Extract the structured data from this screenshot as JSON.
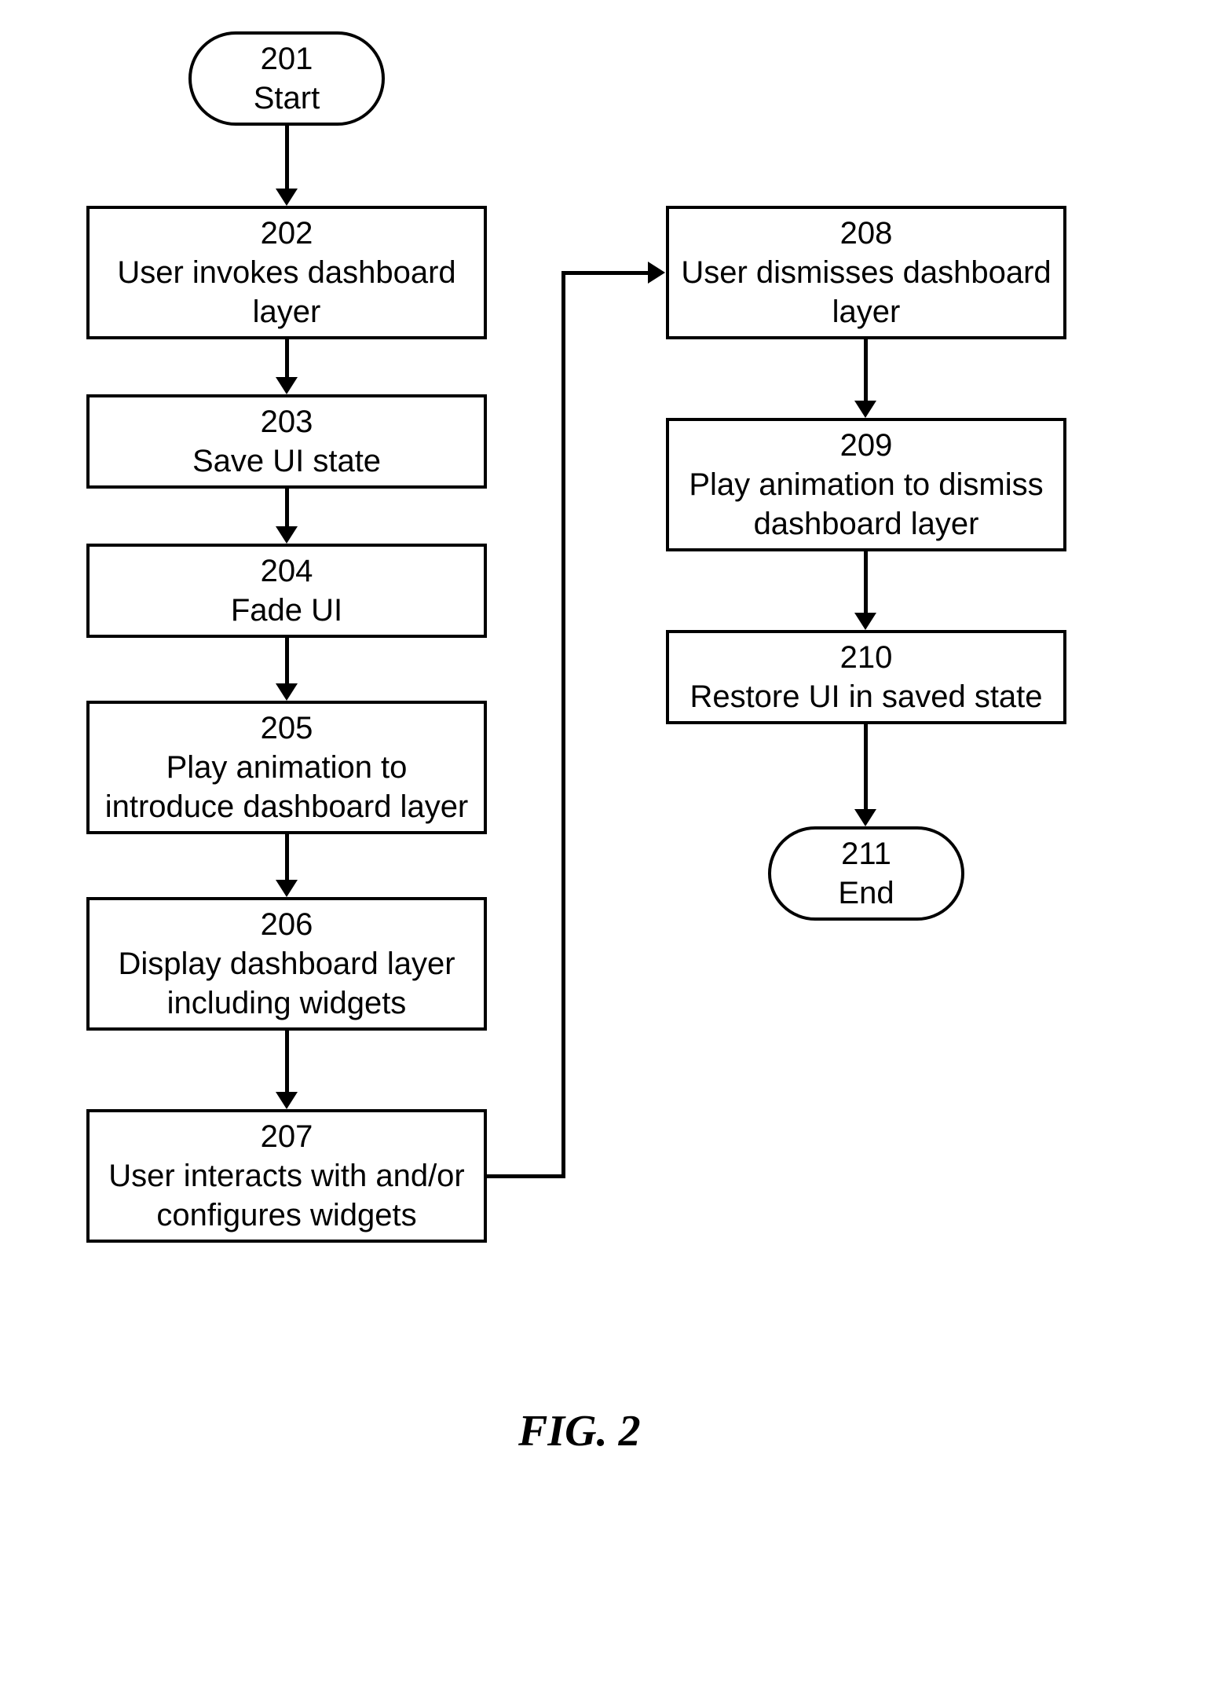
{
  "figure_label": "FIG. 2",
  "nodes": {
    "n201": {
      "num": "201",
      "text": "Start"
    },
    "n202": {
      "num": "202",
      "text": "User invokes dashboard layer"
    },
    "n203": {
      "num": "203",
      "text": "Save UI state"
    },
    "n204": {
      "num": "204",
      "text": "Fade UI"
    },
    "n205": {
      "num": "205",
      "text": "Play animation to introduce dashboard layer"
    },
    "n206": {
      "num": "206",
      "text": "Display dashboard layer including widgets"
    },
    "n207": {
      "num": "207",
      "text": "User interacts with and/or configures widgets"
    },
    "n208": {
      "num": "208",
      "text": "User dismisses dashboard layer"
    },
    "n209": {
      "num": "209",
      "text": "Play animation to dismiss dashboard layer"
    },
    "n210": {
      "num": "210",
      "text": "Restore UI in saved state"
    },
    "n211": {
      "num": "211",
      "text": "End"
    }
  }
}
